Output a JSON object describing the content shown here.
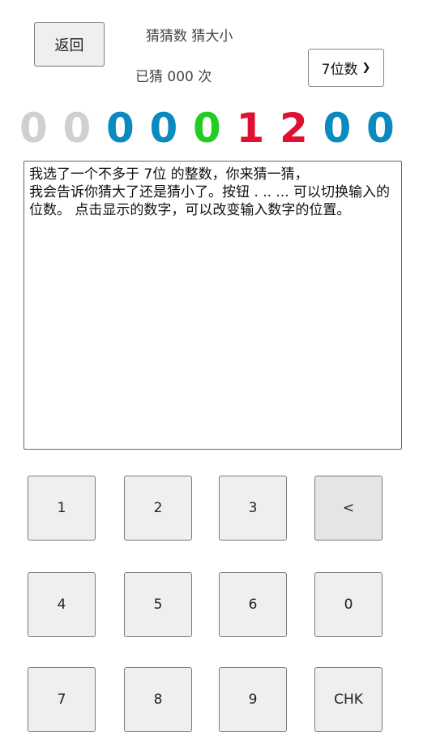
{
  "header": {
    "back_label": "返回",
    "title": "猜猜数 猜大小",
    "counter_prefix": "已猜",
    "counter_value": "000",
    "counter_suffix": "次",
    "digit_select_value": "7位数"
  },
  "digits": [
    {
      "value": "0",
      "color": "#d0d0d0"
    },
    {
      "value": "0",
      "color": "#d0d0d0"
    },
    {
      "value": "0",
      "color": "#0b8ac0"
    },
    {
      "value": "0",
      "color": "#0b8ac0"
    },
    {
      "value": "0",
      "color": "#22cc22"
    },
    {
      "value": "1",
      "color": "#e01030"
    },
    {
      "value": "2",
      "color": "#e01030"
    },
    {
      "value": "0",
      "color": "#0b8ac0"
    },
    {
      "value": "0",
      "color": "#0b8ac0"
    }
  ],
  "message": "我选了一个不多于 7位 的整数，你来猜一猜，\n我会告诉你猜大了还是猜小了。按钮 . .. ... 可以切换输入的位数。 点击显示的数字，可以改变输入数字的位置。",
  "keypad": {
    "k1": "1",
    "k2": "2",
    "k3": "3",
    "back": "<",
    "k4": "4",
    "k5": "5",
    "k6": "6",
    "k0": "0",
    "k7": "7",
    "k8": "8",
    "k9": "9",
    "chk": "CHK"
  }
}
